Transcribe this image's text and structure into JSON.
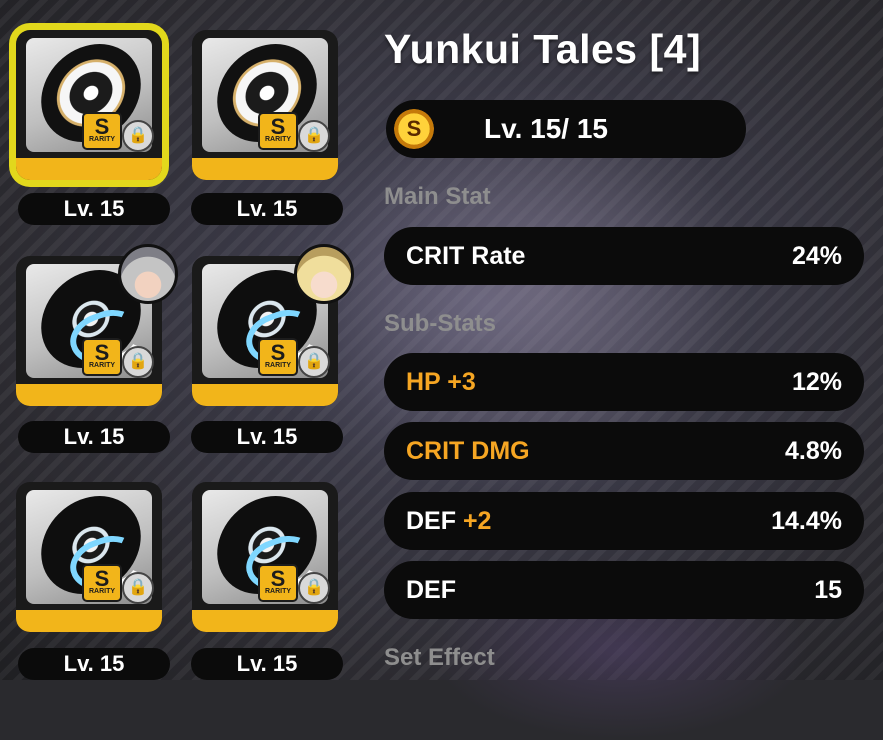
{
  "drive_discs": [
    {
      "level": "Lv. 15",
      "rarity": "S",
      "rarity_label": "RARITY",
      "locked": true,
      "selected": true,
      "equipped_by": null
    },
    {
      "level": "Lv. 15",
      "rarity": "S",
      "rarity_label": "RARITY",
      "locked": true,
      "selected": false,
      "equipped_by": null
    },
    {
      "level": "Lv. 15",
      "rarity": "S",
      "rarity_label": "RARITY",
      "locked": true,
      "selected": false,
      "equipped_by": "silver-haired-agent"
    },
    {
      "level": "Lv. 15",
      "rarity": "S",
      "rarity_label": "RARITY",
      "locked": true,
      "selected": false,
      "equipped_by": "blonde-agent"
    },
    {
      "level": "Lv. 15",
      "rarity": "S",
      "rarity_label": "RARITY",
      "locked": true,
      "selected": false,
      "equipped_by": null
    },
    {
      "level": "Lv. 15",
      "rarity": "S",
      "rarity_label": "RARITY",
      "locked": true,
      "selected": false,
      "equipped_by": null
    }
  ],
  "detail": {
    "title": "Yunkui Tales [4]",
    "rank_icon_letter": "S",
    "level": "Lv. 15/ 15",
    "main_stat_label": "Main Stat",
    "main_stat": {
      "name": "CRIT Rate",
      "value": "24%"
    },
    "sub_stats_label": "Sub-Stats",
    "sub_stats": [
      {
        "name": "HP",
        "bonus": "+3",
        "value": "12%",
        "highlight": true
      },
      {
        "name": "CRIT DMG",
        "bonus": "",
        "value": "4.8%",
        "highlight": true
      },
      {
        "name": "DEF",
        "bonus": "+2",
        "value": "14.4%",
        "highlight": false
      },
      {
        "name": "DEF",
        "bonus": "",
        "value": "15",
        "highlight": false
      }
    ],
    "set_effect_label": "Set Effect"
  },
  "colors": {
    "accent_gold": "#f2b51a",
    "selection_yellow": "#e2d81c",
    "highlight_orange": "#f6a623",
    "pill_black": "#0b0b0b",
    "muted_label": "#8e8e8e"
  },
  "icons": {
    "lock": "lock-icon",
    "rank": "s-rank-icon"
  }
}
